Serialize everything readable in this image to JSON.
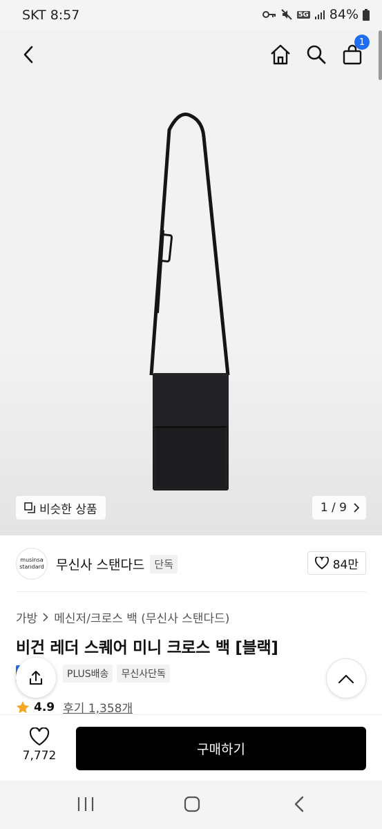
{
  "status_bar": {
    "carrier_time": "SKT 8:57",
    "network": "5G",
    "battery": "84%"
  },
  "top_nav": {
    "cart_count": "1",
    "icons": [
      "back-icon",
      "home-icon",
      "search-icon",
      "cart-icon"
    ]
  },
  "gallery": {
    "similar_label": "비슷한 상품",
    "page_indicator": "1 / 9"
  },
  "brand": {
    "logo_line1": "musinsa",
    "logo_line2": "standard",
    "name": "무신사 스탠다드",
    "exclusive_tag": "단독",
    "likes": "84만"
  },
  "product": {
    "breadcrumb": [
      "가방",
      "메신저/크로스 백 (무신사 스탠다드)"
    ],
    "title": "비건 레더 스퀘어 미니 크로스 백 [블랙]",
    "tags": [
      "PLUS배송",
      "무신사단독"
    ],
    "rating": "4.9",
    "reviews": "후기 1,358개"
  },
  "bottom_bar": {
    "wish_count": "7,772",
    "buy_label": "구매하기"
  },
  "colors": {
    "accent_blue": "#1e6df2",
    "buy_button": "#000000",
    "star": "#f5a623"
  }
}
